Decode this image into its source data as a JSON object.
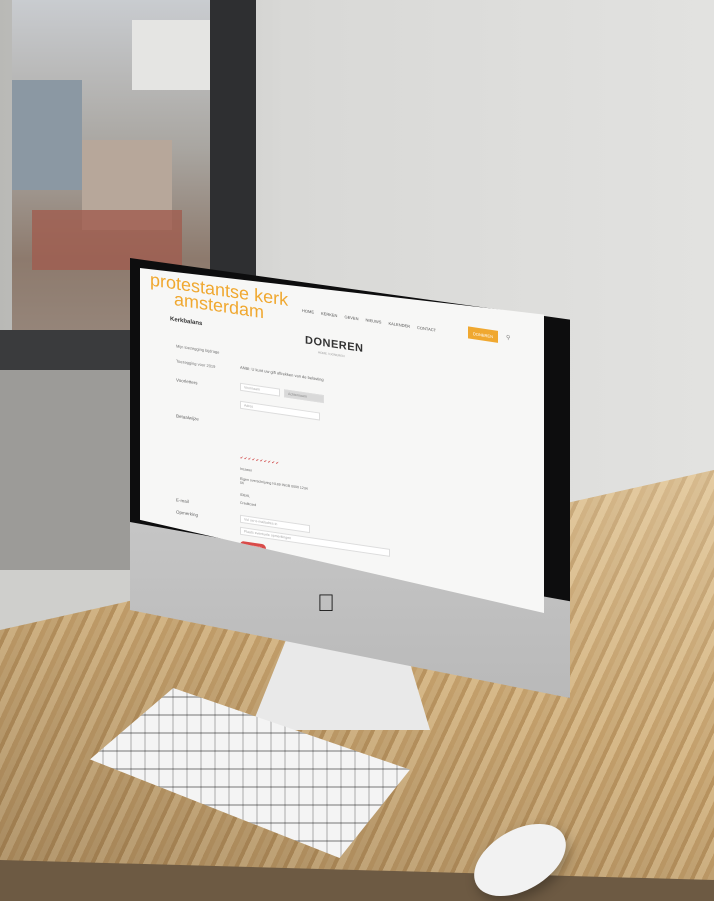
{
  "site": {
    "logo_line1": "protestantse kerk",
    "logo_line2": "amsterdam",
    "brand": "Kerkbalans"
  },
  "nav": {
    "items": [
      "HOME",
      "KERKEN",
      "GEVEN",
      "NIEUWS",
      "KALENDER",
      "CONTACT"
    ],
    "donate": "DONEREN"
  },
  "page": {
    "title": "DONEREN",
    "breadcrumb": "HOME / DONEREN",
    "intro": "ANBI: U kunt uw gift aftrekken van de belasting",
    "side_items": [
      "Mijn toezegging bijdrage",
      "Toezegging voor 2019"
    ]
  },
  "form": {
    "labels": [
      "Voorletters",
      "Betaalwijze",
      "E-mail",
      "Opmerking"
    ],
    "field_first": "Voornaam",
    "field_last": "Achternaam",
    "select_value": "Adres",
    "radio_options": [
      "Incasso",
      "Eigen overschrijving NL89 INGB 0000 1234 56",
      "IDEAL",
      "Creditcard"
    ],
    "email_placeholder": "Vul uw e-mailadres in",
    "note_placeholder": "Plaats eventuele opmerkingen",
    "submit": "AFRONDEN",
    "checks": "✔✔✔✔✔✔✔✔✔✔"
  },
  "colors": {
    "logo_orange": "#f0a830",
    "logo_accent": "#c2185b",
    "submit_red": "#d94b49"
  }
}
